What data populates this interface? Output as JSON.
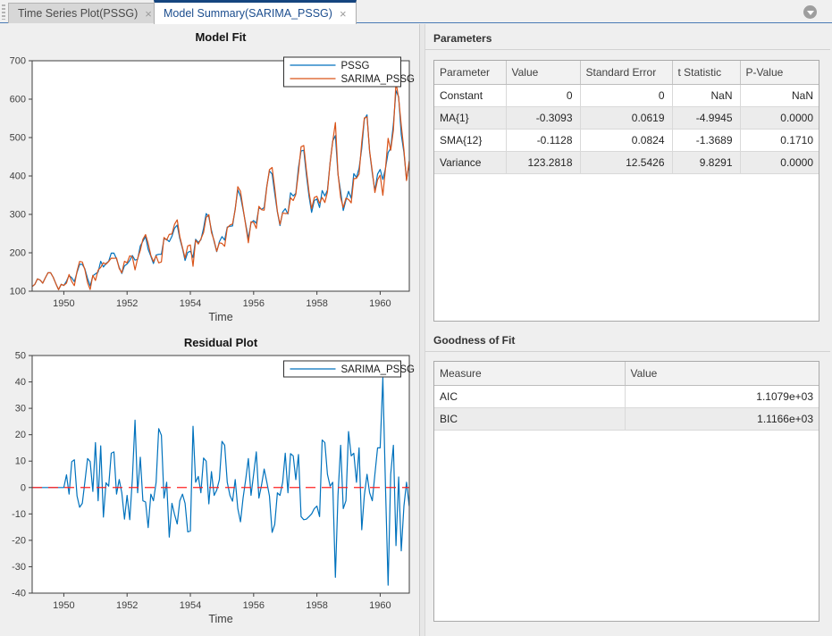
{
  "tabs": {
    "close_glyph": "×",
    "items": [
      {
        "label": "Time Series Plot(PSSG)",
        "active": false
      },
      {
        "label": "Model Summary(SARIMA_PSSG)",
        "active": true
      }
    ]
  },
  "colors": {
    "pssg_line": "#0072BD",
    "sarima_line": "#D95319",
    "zero_line": "#ff2121",
    "active_tab_accent": "#15457f",
    "panel_background": "#efefef"
  },
  "parameters_section": {
    "title": "Parameters",
    "table": {
      "headers": [
        "Parameter",
        "Value",
        "Standard Error",
        "t Statistic",
        "P-Value"
      ],
      "rows": [
        [
          "Constant",
          "0",
          "0",
          "NaN",
          "NaN"
        ],
        [
          "MA{1}",
          "-0.3093",
          "0.0619",
          "-4.9945",
          "0.0000"
        ],
        [
          "SMA{12}",
          "-0.1128",
          "0.0824",
          "-1.3689",
          "0.1710"
        ],
        [
          "Variance",
          "123.2818",
          "12.5426",
          "9.8291",
          "0.0000"
        ]
      ]
    }
  },
  "goodness_section": {
    "title": "Goodness of Fit",
    "table": {
      "headers": [
        "Measure",
        "Value"
      ],
      "rows": [
        [
          "AIC",
          "1.1079e+03"
        ],
        [
          "BIC",
          "1.1166e+03"
        ]
      ]
    }
  },
  "chart_data": [
    {
      "type": "line",
      "title": "Model Fit",
      "xlabel": "Time",
      "x_start": 1949,
      "x_step": 0.0833333,
      "xlim": [
        1949,
        1960.92
      ],
      "ylim": [
        100,
        700
      ],
      "xticks": [
        1950,
        1952,
        1954,
        1956,
        1958,
        1960
      ],
      "yticks": [
        100,
        200,
        300,
        400,
        500,
        600,
        700
      ],
      "grid": false,
      "legend_position": "top-right-inside",
      "series": [
        {
          "name": "PSSG",
          "color": "#0072BD",
          "values": [
            112,
            118,
            132,
            129,
            121,
            135,
            148,
            148,
            136,
            119,
            104,
            118,
            115,
            126,
            141,
            135,
            125,
            149,
            170,
            170,
            158,
            133,
            114,
            140,
            145,
            150,
            178,
            163,
            172,
            178,
            199,
            199,
            184,
            162,
            146,
            166,
            171,
            180,
            193,
            181,
            183,
            218,
            230,
            242,
            209,
            191,
            172,
            194,
            196,
            196,
            236,
            235,
            229,
            243,
            264,
            272,
            237,
            211,
            180,
            201,
            204,
            188,
            235,
            227,
            234,
            264,
            302,
            293,
            259,
            229,
            203,
            229,
            242,
            233,
            267,
            269,
            270,
            315,
            364,
            347,
            312,
            274,
            237,
            278,
            284,
            277,
            317,
            313,
            318,
            374,
            413,
            405,
            355,
            306,
            271,
            306,
            315,
            301,
            356,
            348,
            355,
            422,
            465,
            467,
            404,
            347,
            305,
            336,
            340,
            318,
            362,
            348,
            363,
            435,
            491,
            505,
            404,
            359,
            310,
            337,
            360,
            342,
            406,
            396,
            420,
            472,
            548,
            559,
            463,
            407,
            362,
            405,
            417,
            391,
            419,
            461,
            472,
            535,
            622,
            606,
            508,
            461,
            390,
            432
          ]
        },
        {
          "name": "SARIMA_PSSG",
          "color": "#D95319",
          "derivation": "fitted values = PSSG minus residuals (residual series below); first 13 residuals are 0 so the curves overlap there"
        }
      ]
    },
    {
      "type": "line",
      "title": "Residual Plot",
      "xlabel": "Time",
      "x_start": 1949,
      "x_step": 0.0833333,
      "xlim": [
        1949,
        1960.92
      ],
      "ylim": [
        -40,
        50
      ],
      "xticks": [
        1950,
        1952,
        1954,
        1956,
        1958,
        1960
      ],
      "yticks": [
        -40,
        -30,
        -20,
        -10,
        0,
        10,
        20,
        30,
        40,
        50
      ],
      "grid": false,
      "legend_position": "top-right-inside",
      "zero_line": {
        "y": 0,
        "color": "#ff2121",
        "style": "dashed"
      },
      "series": [
        {
          "name": "SARIMA_PSSG",
          "color": "#0072BD",
          "values": [
            0,
            0,
            0,
            0,
            0,
            0,
            0,
            0,
            0,
            0,
            0,
            0,
            0,
            4.8,
            -2.5,
            9.8,
            10.5,
            -3.2,
            -7.5,
            -6,
            2.2,
            11,
            9.8,
            -1.5,
            17,
            -5,
            15.8,
            -11.2,
            1.8,
            0.5,
            13,
            13.5,
            -2.5,
            3,
            -2,
            -12,
            -3,
            -12.2,
            3.2,
            25.5,
            -2,
            11.5,
            -5,
            -5.5,
            -15.2,
            -2.5,
            -5,
            2,
            22.3,
            19.8,
            -4,
            2,
            -18.8,
            -6,
            -10.2,
            -13.8,
            -5,
            -2.5,
            -6,
            -16.8,
            -16.5,
            23.2,
            2,
            4.2,
            -2,
            11.2,
            10,
            -6.2,
            6,
            -3,
            -1,
            3,
            17.5,
            16,
            2,
            -3,
            -5.2,
            3,
            -8,
            -13,
            -4,
            3.2,
            11,
            -3,
            5,
            13.5,
            -4,
            1,
            7,
            2,
            -3.2,
            -17,
            -14,
            -2,
            -3,
            2,
            13,
            -2,
            12.8,
            12,
            3,
            12.5,
            -11,
            -12.2,
            -12,
            -11,
            -10,
            -8,
            -7,
            -11,
            18,
            17,
            5,
            0.5,
            2,
            -34,
            -3,
            16,
            -8,
            -5,
            21.2,
            12,
            13,
            2,
            15,
            -16,
            -3,
            5,
            -2,
            -5,
            5,
            15,
            15,
            41.5,
            1,
            -37,
            5,
            16,
            -22,
            4,
            -24,
            -7,
            2,
            -7
          ]
        }
      ]
    }
  ]
}
